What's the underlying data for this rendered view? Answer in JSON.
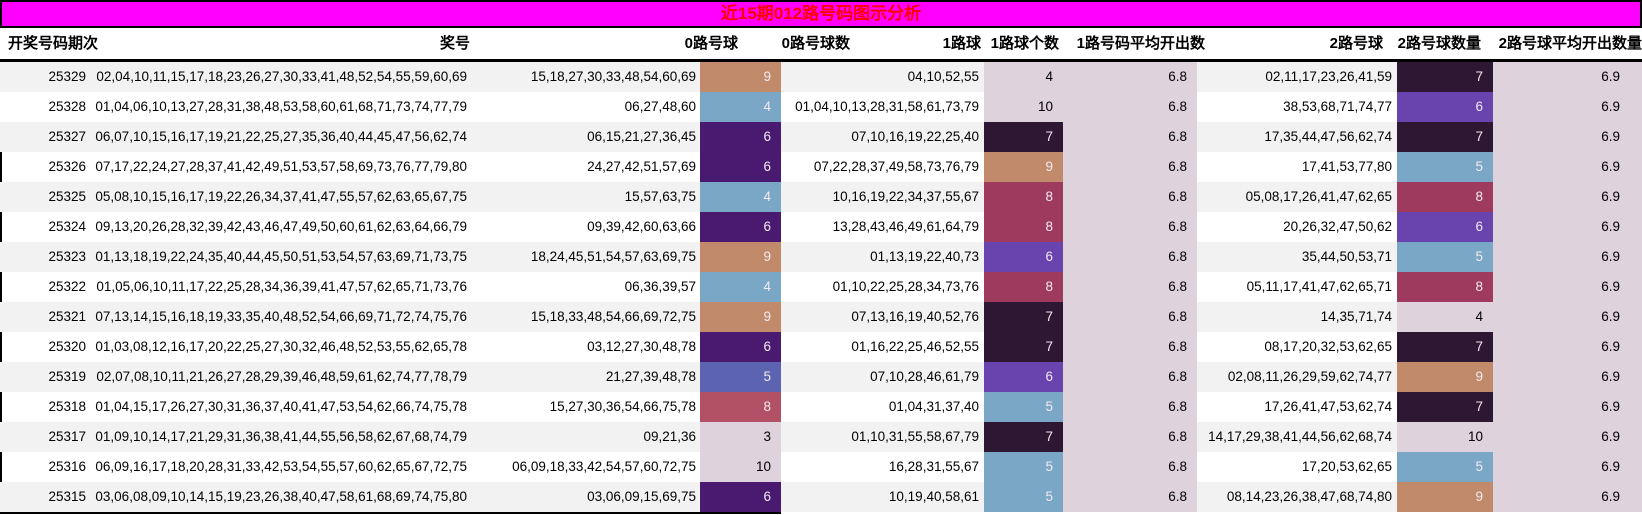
{
  "title": "近15期012路号码图示分析",
  "columns": [
    "开奖号码期次",
    "奖号",
    "0路号球",
    "0路号球数",
    "1路球",
    "1路球个数",
    "1路号码平均开出数",
    "2路号球",
    "2路号球数量",
    "2路号球平均开出数量"
  ],
  "colors": {
    "title_bg": "#ff00ff",
    "title_text": "#ff0000",
    "stripe": "#f2f2f2",
    "count_text": "#f2eaf2",
    "scale": {
      "plain": "#ded2dd",
      "steel": "#7ba7c7",
      "slate": "#5c63b0",
      "violet": "#6a44ae",
      "purple": "#4a1a70",
      "darkest": "#2d1733",
      "maroon": "#9e3a5e",
      "maroon_light": "#b25066",
      "tan": "#c18a6b"
    }
  },
  "rows": [
    {
      "period": "25329",
      "numbers": "02,04,10,11,15,17,18,23,26,27,30,33,41,48,52,54,55,59,60,69",
      "r0_balls": "15,18,27,30,33,48,54,60,69",
      "r0_count": "9",
      "r0_color": "tan",
      "r1_balls": "04,10,52,55",
      "r1_count": "4",
      "r1_color": "plain",
      "r1_avg": "6.8",
      "r2_balls": "02,11,17,23,26,41,59",
      "r2_count": "7",
      "r2_color": "darkest",
      "r2_avg": "6.9"
    },
    {
      "period": "25328",
      "numbers": "01,04,06,10,13,27,28,31,38,48,53,58,60,61,68,71,73,74,77,79",
      "r0_balls": "06,27,48,60",
      "r0_count": "4",
      "r0_color": "steel",
      "r1_balls": "01,04,10,13,28,31,58,61,73,79",
      "r1_count": "10",
      "r1_color": "plain",
      "r1_avg": "6.8",
      "r2_balls": "38,53,68,71,74,77",
      "r2_count": "6",
      "r2_color": "violet",
      "r2_avg": "6.9"
    },
    {
      "period": "25327",
      "numbers": "06,07,10,15,16,17,19,21,22,25,27,35,36,40,44,45,47,56,62,74",
      "r0_balls": "06,15,21,27,36,45",
      "r0_count": "6",
      "r0_color": "purple",
      "r1_balls": "07,10,16,19,22,25,40",
      "r1_count": "7",
      "r1_color": "darkest",
      "r1_avg": "6.8",
      "r2_balls": "17,35,44,47,56,62,74",
      "r2_count": "7",
      "r2_color": "darkest",
      "r2_avg": "6.9"
    },
    {
      "period": "25326",
      "numbers": "07,17,22,24,27,28,37,41,42,49,51,53,57,58,69,73,76,77,79,80",
      "r0_balls": "24,27,42,51,57,69",
      "r0_count": "6",
      "r0_color": "purple",
      "r1_balls": "07,22,28,37,49,58,73,76,79",
      "r1_count": "9",
      "r1_color": "tan",
      "r1_avg": "6.8",
      "r2_balls": "17,41,53,77,80",
      "r2_count": "5",
      "r2_color": "steel",
      "r2_avg": "6.9"
    },
    {
      "period": "25325",
      "numbers": "05,08,10,15,16,17,19,22,26,34,37,41,47,55,57,62,63,65,67,75",
      "r0_balls": "15,57,63,75",
      "r0_count": "4",
      "r0_color": "steel",
      "r1_balls": "10,16,19,22,34,37,55,67",
      "r1_count": "8",
      "r1_color": "maroon",
      "r1_avg": "6.8",
      "r2_balls": "05,08,17,26,41,47,62,65",
      "r2_count": "8",
      "r2_color": "maroon",
      "r2_avg": "6.9"
    },
    {
      "period": "25324",
      "numbers": "09,13,20,26,28,32,39,42,43,46,47,49,50,60,61,62,63,64,66,79",
      "r0_balls": "09,39,42,60,63,66",
      "r0_count": "6",
      "r0_color": "purple",
      "r1_balls": "13,28,43,46,49,61,64,79",
      "r1_count": "8",
      "r1_color": "maroon",
      "r1_avg": "6.8",
      "r2_balls": "20,26,32,47,50,62",
      "r2_count": "6",
      "r2_color": "violet",
      "r2_avg": "6.9"
    },
    {
      "period": "25323",
      "numbers": "01,13,18,19,22,24,35,40,44,45,50,51,53,54,57,63,69,71,73,75",
      "r0_balls": "18,24,45,51,54,57,63,69,75",
      "r0_count": "9",
      "r0_color": "tan",
      "r1_balls": "01,13,19,22,40,73",
      "r1_count": "6",
      "r1_color": "violet",
      "r1_avg": "6.8",
      "r2_balls": "35,44,50,53,71",
      "r2_count": "5",
      "r2_color": "steel",
      "r2_avg": "6.9"
    },
    {
      "period": "25322",
      "numbers": "01,05,06,10,11,17,22,25,28,34,36,39,41,47,57,62,65,71,73,76",
      "r0_balls": "06,36,39,57",
      "r0_count": "4",
      "r0_color": "steel",
      "r1_balls": "01,10,22,25,28,34,73,76",
      "r1_count": "8",
      "r1_color": "maroon",
      "r1_avg": "6.8",
      "r2_balls": "05,11,17,41,47,62,65,71",
      "r2_count": "8",
      "r2_color": "maroon",
      "r2_avg": "6.9"
    },
    {
      "period": "25321",
      "numbers": "07,13,14,15,16,18,19,33,35,40,48,52,54,66,69,71,72,74,75,76",
      "r0_balls": "15,18,33,48,54,66,69,72,75",
      "r0_count": "9",
      "r0_color": "tan",
      "r1_balls": "07,13,16,19,40,52,76",
      "r1_count": "7",
      "r1_color": "darkest",
      "r1_avg": "6.8",
      "r2_balls": "14,35,71,74",
      "r2_count": "4",
      "r2_color": "plain",
      "r2_avg": "6.9"
    },
    {
      "period": "25320",
      "numbers": "01,03,08,12,16,17,20,22,25,27,30,32,46,48,52,53,55,62,65,78",
      "r0_balls": "03,12,27,30,48,78",
      "r0_count": "6",
      "r0_color": "purple",
      "r1_balls": "01,16,22,25,46,52,55",
      "r1_count": "7",
      "r1_color": "darkest",
      "r1_avg": "6.8",
      "r2_balls": "08,17,20,32,53,62,65",
      "r2_count": "7",
      "r2_color": "darkest",
      "r2_avg": "6.9"
    },
    {
      "period": "25319",
      "numbers": "02,07,08,10,11,21,26,27,28,29,39,46,48,59,61,62,74,77,78,79",
      "r0_balls": "21,27,39,48,78",
      "r0_count": "5",
      "r0_color": "slate",
      "r1_balls": "07,10,28,46,61,79",
      "r1_count": "6",
      "r1_color": "violet",
      "r1_avg": "6.8",
      "r2_balls": "02,08,11,26,29,59,62,74,77",
      "r2_count": "9",
      "r2_color": "tan",
      "r2_avg": "6.9"
    },
    {
      "period": "25318",
      "numbers": "01,04,15,17,26,27,30,31,36,37,40,41,47,53,54,62,66,74,75,78",
      "r0_balls": "15,27,30,36,54,66,75,78",
      "r0_count": "8",
      "r0_color": "maroon_light",
      "r1_balls": "01,04,31,37,40",
      "r1_count": "5",
      "r1_color": "steel",
      "r1_avg": "6.8",
      "r2_balls": "17,26,41,47,53,62,74",
      "r2_count": "7",
      "r2_color": "darkest",
      "r2_avg": "6.9"
    },
    {
      "period": "25317",
      "numbers": "01,09,10,14,17,21,29,31,36,38,41,44,55,56,58,62,67,68,74,79",
      "r0_balls": "09,21,36",
      "r0_count": "3",
      "r0_color": "plain",
      "r1_balls": "01,10,31,55,58,67,79",
      "r1_count": "7",
      "r1_color": "darkest",
      "r1_avg": "6.8",
      "r2_balls": "14,17,29,38,41,44,56,62,68,74",
      "r2_count": "10",
      "r2_color": "plain",
      "r2_avg": "6.9"
    },
    {
      "period": "25316",
      "numbers": "06,09,16,17,18,20,28,31,33,42,53,54,55,57,60,62,65,67,72,75",
      "r0_balls": "06,09,18,33,42,54,57,60,72,75",
      "r0_count": "10",
      "r0_color": "plain",
      "r1_balls": "16,28,31,55,67",
      "r1_count": "5",
      "r1_color": "steel",
      "r1_avg": "6.8",
      "r2_balls": "17,20,53,62,65",
      "r2_count": "5",
      "r2_color": "steel",
      "r2_avg": "6.9"
    },
    {
      "period": "25315",
      "numbers": "03,06,08,09,10,14,15,19,23,26,38,40,47,58,61,68,69,74,75,80",
      "r0_balls": "03,06,09,15,69,75",
      "r0_count": "6",
      "r0_color": "purple",
      "r1_balls": "10,19,40,58,61",
      "r1_count": "5",
      "r1_color": "steel",
      "r1_avg": "6.8",
      "r2_balls": "08,14,23,26,38,47,68,74,80",
      "r2_count": "9",
      "r2_color": "tan",
      "r2_avg": "6.9"
    }
  ]
}
